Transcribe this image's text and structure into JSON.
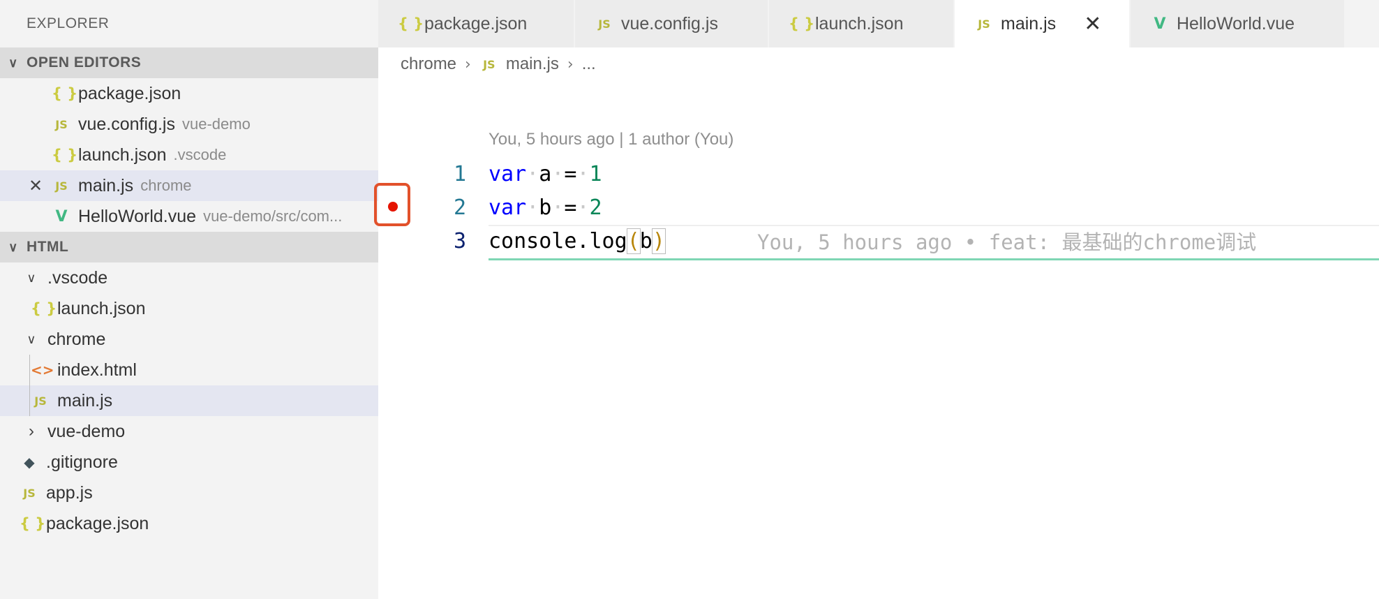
{
  "explorer": {
    "title": "EXPLORER",
    "open_editors": {
      "label": "OPEN EDITORS",
      "items": [
        {
          "name": "package.json",
          "desc": ""
        },
        {
          "name": "vue.config.js",
          "desc": "vue-demo"
        },
        {
          "name": "launch.json",
          "desc": ".vscode"
        },
        {
          "name": "main.js",
          "desc": "chrome"
        },
        {
          "name": "HelloWorld.vue",
          "desc": "vue-demo/src/com..."
        }
      ]
    },
    "project": {
      "label": "HTML",
      "items": [
        {
          "name": ".vscode"
        },
        {
          "name": "launch.json"
        },
        {
          "name": "chrome"
        },
        {
          "name": "index.html"
        },
        {
          "name": "main.js"
        },
        {
          "name": "vue-demo"
        },
        {
          "name": ".gitignore"
        },
        {
          "name": "app.js"
        },
        {
          "name": "package.json"
        }
      ]
    }
  },
  "tabs": [
    {
      "label": "package.json"
    },
    {
      "label": "vue.config.js"
    },
    {
      "label": "launch.json"
    },
    {
      "label": "main.js"
    },
    {
      "label": "HelloWorld.vue"
    }
  ],
  "breadcrumb": {
    "folder": "chrome",
    "file": "main.js",
    "more": "..."
  },
  "editor": {
    "codelens": "You, 5 hours ago | 1 author (You)",
    "lines": [
      {
        "num": "1",
        "kw": "var",
        "name": "a",
        "op": "=",
        "value": "1"
      },
      {
        "num": "2",
        "kw": "var",
        "name": "b",
        "op": "=",
        "value": "2"
      },
      {
        "num": "3",
        "obj": "console.log",
        "open": "(",
        "arg": "b",
        "close": ")"
      }
    ],
    "blame": "You, 5 hours ago • feat: 最基础的chrome调试"
  },
  "icons": {
    "json": "{ }",
    "js": "JS",
    "vue": "V",
    "html": "<>",
    "git": "◆"
  },
  "colors": {
    "breakpoint": "#e51400",
    "highlight": "#e2512b",
    "keyword": "#0000ff",
    "number": "#098658"
  }
}
